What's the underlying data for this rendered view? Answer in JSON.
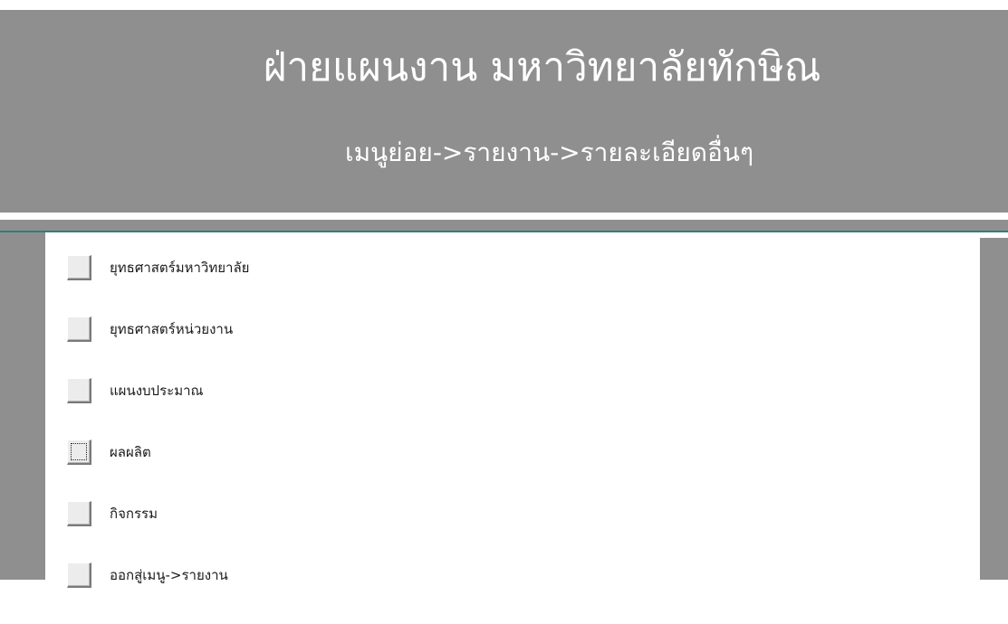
{
  "header": {
    "title": "ฝ่ายแผนงาน  มหาวิทยาลัยทักษิณ",
    "subtitle": "เมนูย่อย->รายงาน->รายละเอียดอื่นๆ"
  },
  "menu": {
    "items": [
      {
        "label": "ยุทธศาสตร์มหาวิทยาลัย",
        "focused": false
      },
      {
        "label": "ยุทธศาสตร์หน่วยงาน",
        "focused": false
      },
      {
        "label": "แผนงบประมาณ",
        "focused": false
      },
      {
        "label": "ผลผลิต",
        "focused": true
      },
      {
        "label": "กิจกรรม",
        "focused": false
      },
      {
        "label": "ออกสู่เมนู->รายงาน",
        "focused": false
      }
    ]
  },
  "colors": {
    "header_bg": "#8f8f8f",
    "header_text": "#ffffff",
    "divider_accent": "#2f7f7a",
    "button_face": "#ececec"
  }
}
